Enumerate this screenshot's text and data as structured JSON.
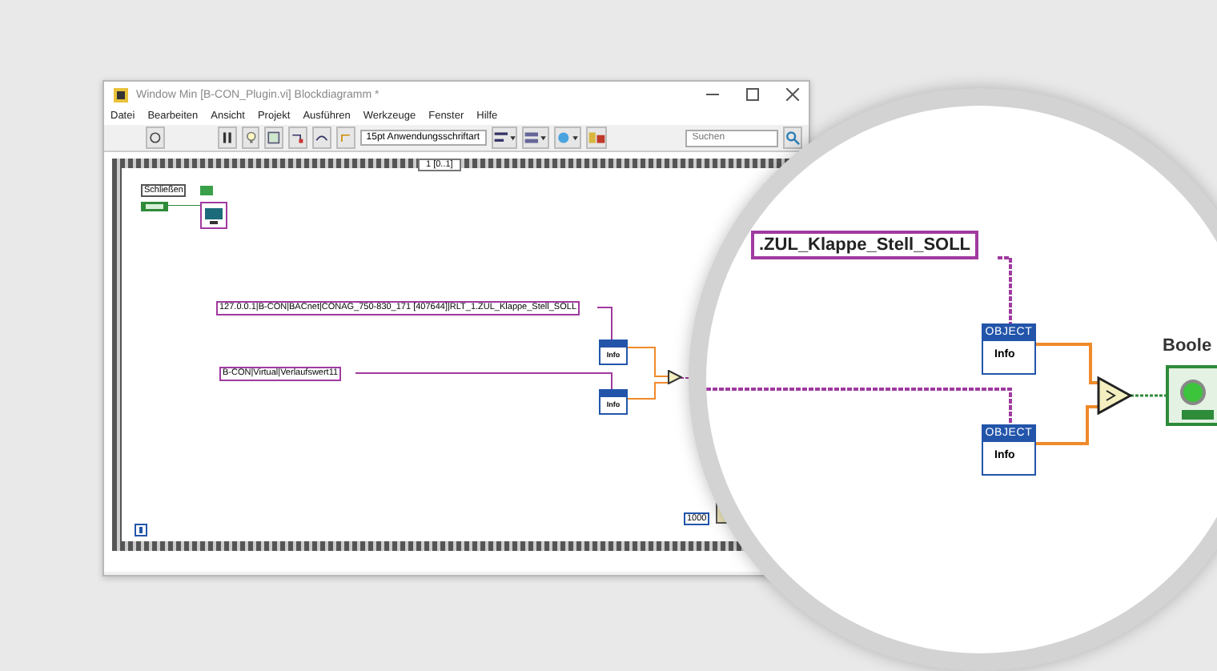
{
  "window": {
    "title": "Window Min [B-CON_Plugin.vi] Blockdiagramm *"
  },
  "menu": [
    "Datei",
    "Bearbeiten",
    "Ansicht",
    "Projekt",
    "Ausführen",
    "Werkzeuge",
    "Fenster",
    "Hilfe"
  ],
  "toolbar": {
    "font_selector": "15pt Anwendungsschriftart",
    "search": {
      "placeholder": "Suchen"
    }
  },
  "diagram": {
    "frame_selector": "1 [0..1]",
    "close_label": "Schließen",
    "constants": [
      {
        "text": "127.0.0.1|B-CON|BACnet|CONAG_750-830_171 [407644]|RLT_1.ZUL_Klappe_Stell_SOLL"
      },
      {
        "text": "B-CON|Virtual|Verlaufswert11"
      }
    ],
    "nodes": [
      {
        "label": "Info"
      },
      {
        "label": "Info"
      }
    ],
    "wait_constant": "1000"
  },
  "magnifier": {
    "constant": ".ZUL_Klappe_Stell_SOLL",
    "nodes": [
      {
        "header": "OBJECT",
        "label": "Info"
      },
      {
        "header": "OBJECT",
        "label": "Info"
      }
    ],
    "indicator": {
      "label": "Boole",
      "on": true
    }
  }
}
